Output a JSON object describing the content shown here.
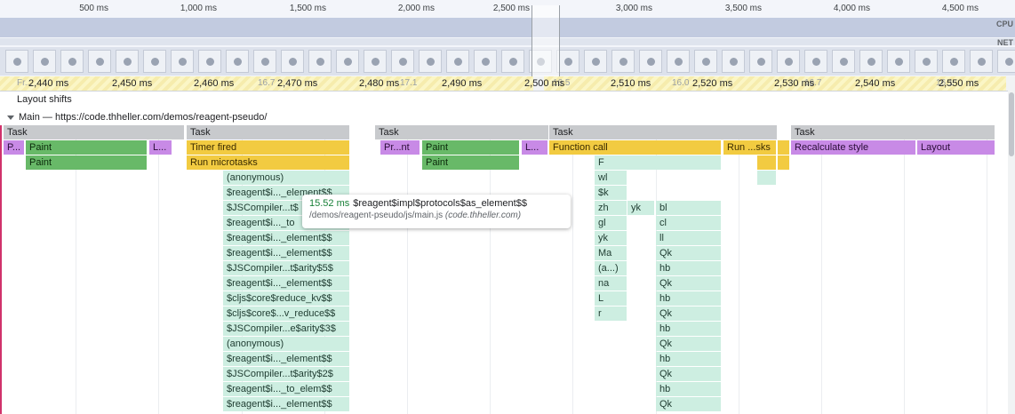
{
  "overview": {
    "time_labels": [
      "500 ms",
      "1,000 ms",
      "1,500 ms",
      "2,000 ms",
      "2,500 ms",
      "3,000 ms",
      "3,500 ms",
      "4,000 ms",
      "4,500 ms"
    ],
    "cpu_label": "CPU",
    "net_label": "NET"
  },
  "ruler": {
    "labels": [
      "2,440 ms",
      "2,450 ms",
      "2,460 ms",
      "2,470 ms",
      "2,480 ms",
      "2,490 ms",
      "2,500 ms",
      "2,510 ms",
      "2,520 ms",
      "2,530 ms",
      "2,540 ms",
      "2,550 ms"
    ],
    "frames_label": "Fr...",
    "frame_times": [
      "16.7",
      "17.1",
      "16.5",
      "16.0",
      "16.7",
      "16.1"
    ]
  },
  "tracks": {
    "layout_shifts": "Layout shifts",
    "main_thread": "Main — https://code.thheller.com/demos/reagent-pseudo/"
  },
  "flame": {
    "tasks": [
      "Task",
      "Task",
      "Task",
      "Task",
      "Task"
    ],
    "row1": [
      "P...",
      "Paint",
      "L...",
      "Timer fired",
      "Pr...nt",
      "Paint",
      "L...",
      "Function call",
      "Run ...sks",
      "Recalculate style",
      "Layout"
    ],
    "row2": [
      "Paint",
      "Run microtasks",
      "Paint",
      "F"
    ],
    "colA": [
      "(anonymous)",
      "$reagent$i..._element$$",
      "$JSCompiler...t$",
      "$reagent$i..._to",
      "$reagent$i..._element$$",
      "$reagent$i..._element$$",
      "$JSCompiler...t$arity$5$",
      "$reagent$i..._element$$",
      "$cljs$core$reduce_kv$$",
      "$cljs$core$...v_reduce$$",
      "$JSCompiler...e$arity$3$",
      "(anonymous)",
      "$reagent$i..._element$$",
      "$JSCompiler...t$arity$2$",
      "$reagent$i..._to_elem$$",
      "$reagent$i..._element$$"
    ],
    "colB": [
      "wl",
      "$k",
      "zh",
      "gl",
      "yk",
      "Ma",
      "(a...)",
      "na",
      "L",
      "r"
    ],
    "colB2": [
      "yk"
    ],
    "colC": [
      "bl",
      "cl",
      "ll",
      "Qk",
      "hb",
      "Qk",
      "hb",
      "Qk",
      "hb",
      "Qk",
      "hb",
      "Qk",
      "hb",
      "Qk"
    ]
  },
  "tooltip": {
    "duration": "15.52 ms",
    "function": "$reagent$impl$protocols$as_element$$",
    "url": "/demos/reagent-pseudo/js/main.js",
    "origin": "(code.thheller.com)"
  }
}
